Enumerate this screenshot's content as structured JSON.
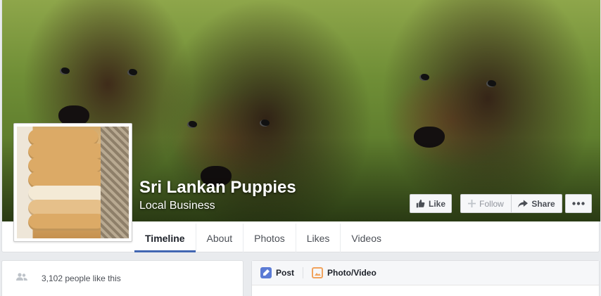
{
  "page": {
    "name": "Sri Lankan Puppies",
    "category": "Local Business"
  },
  "actions": {
    "like": "Like",
    "follow": "Follow",
    "share": "Share"
  },
  "tabs": [
    {
      "label": "Timeline",
      "active": true
    },
    {
      "label": "About"
    },
    {
      "label": "Photos"
    },
    {
      "label": "Likes"
    },
    {
      "label": "Videos"
    }
  ],
  "likes": {
    "text": "3,102 people like this"
  },
  "composer": {
    "post": "Post",
    "photo_video": "Photo/Video"
  },
  "icons": {
    "like": "thumbs-up-icon",
    "follow": "plus-icon",
    "share": "share-arrow-icon",
    "more": "ellipsis-icon",
    "people": "people-icon",
    "post": "pencil-icon",
    "photo": "photo-icon"
  },
  "colors": {
    "accent": "#4267b2",
    "post_icon": "#5b7bd5",
    "photo_icon": "#f1a35d"
  }
}
